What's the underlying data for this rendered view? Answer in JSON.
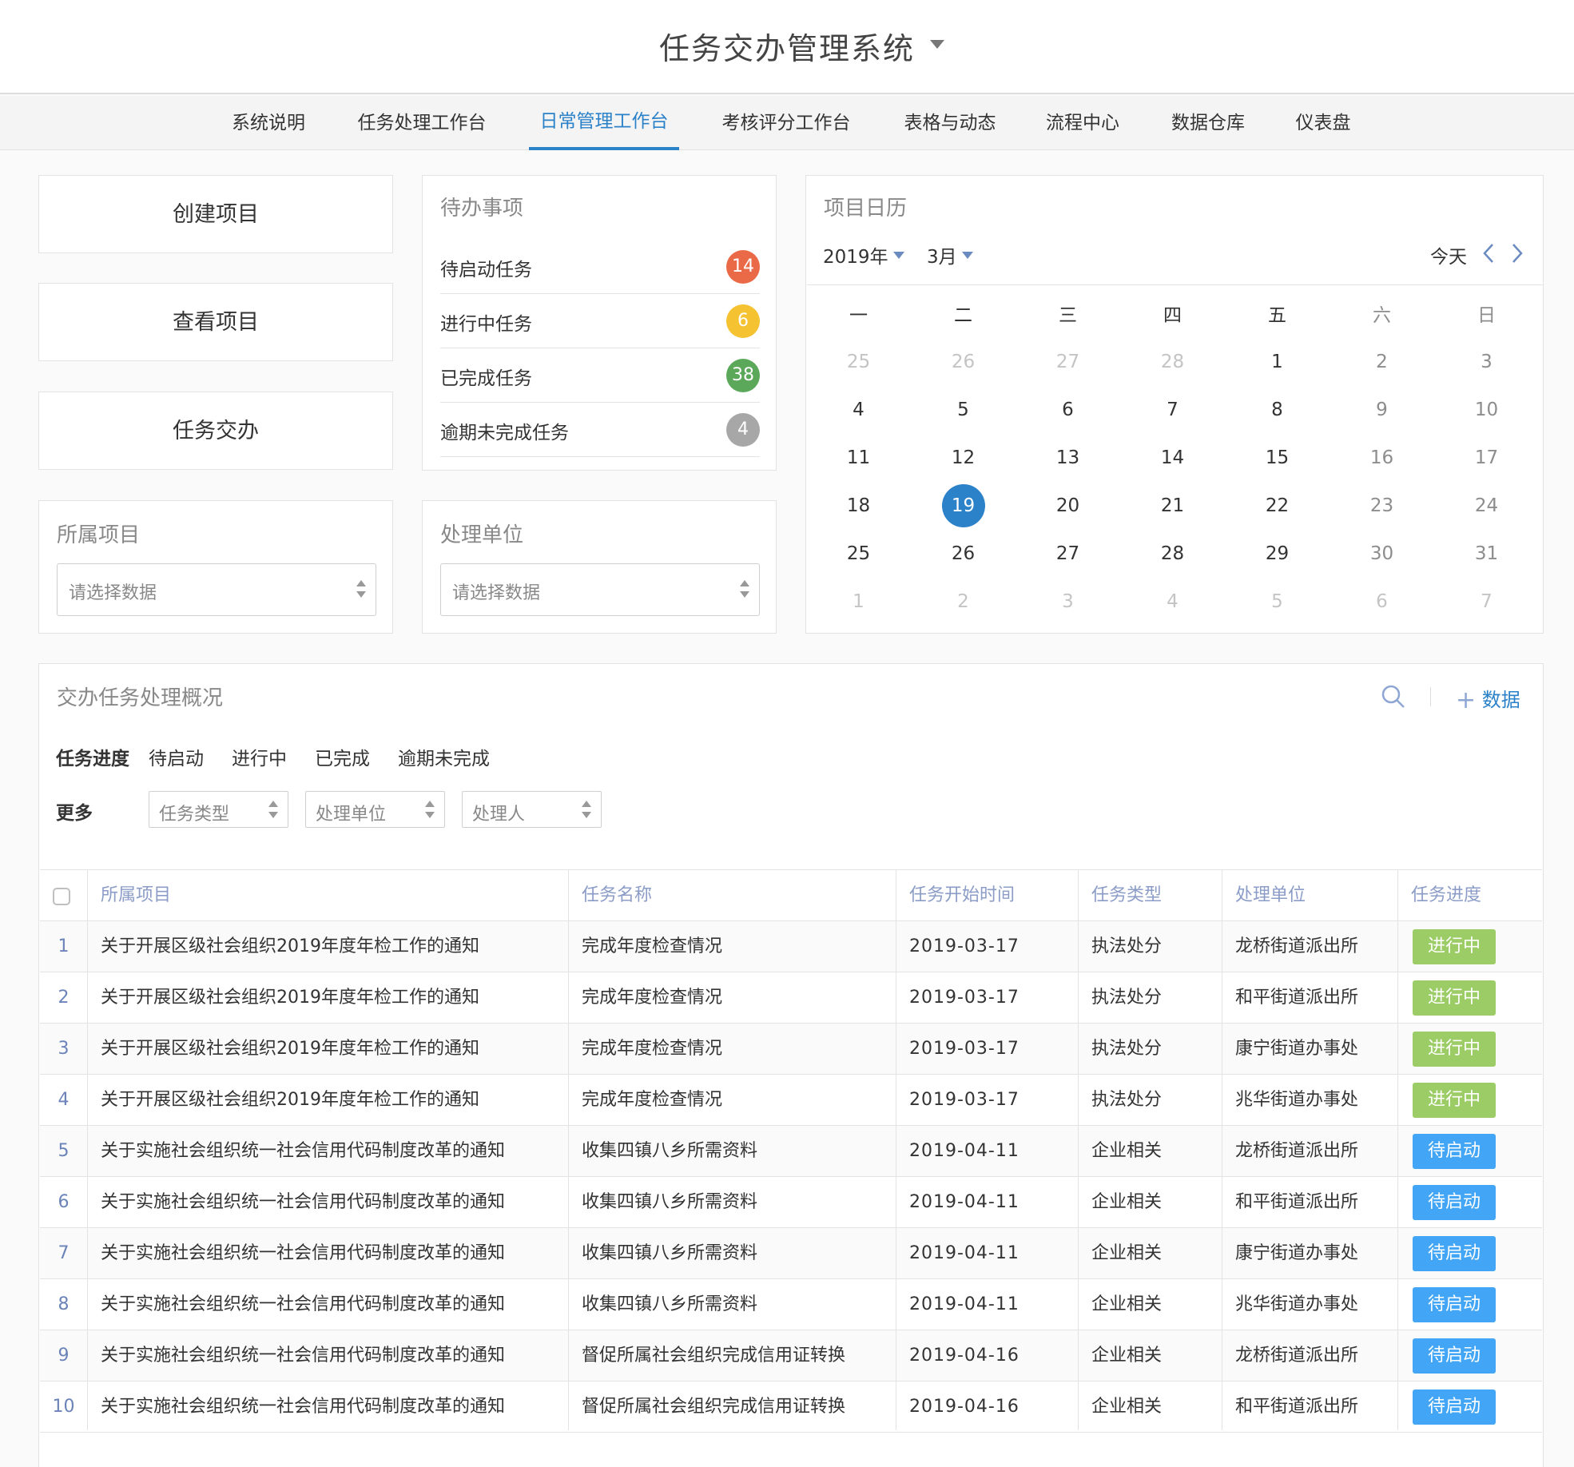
{
  "app": {
    "title": "任务交办管理系统"
  },
  "nav": {
    "tabs": [
      {
        "label": "系统说明"
      },
      {
        "label": "任务处理工作台"
      },
      {
        "label": "日常管理工作台",
        "active": true
      },
      {
        "label": "考核评分工作台"
      },
      {
        "label": "表格与动态"
      },
      {
        "label": "流程中心"
      },
      {
        "label": "数据仓库"
      },
      {
        "label": "仪表盘"
      }
    ]
  },
  "actions": {
    "create": "创建项目",
    "view": "查看项目",
    "assign": "任务交办"
  },
  "todo": {
    "title": "待办事项",
    "items": [
      {
        "label": "待启动任务",
        "count": "14",
        "color": "#ea6a48"
      },
      {
        "label": "进行中任务",
        "count": "6",
        "color": "#f5c232"
      },
      {
        "label": "已完成任务",
        "count": "38",
        "color": "#5ca85a"
      },
      {
        "label": "逾期未完成任务",
        "count": "4",
        "color": "#a7a7a7"
      }
    ]
  },
  "project_filter": {
    "title": "所属项目",
    "placeholder": "请选择数据"
  },
  "unit_filter": {
    "title": "处理单位",
    "placeholder": "请选择数据"
  },
  "calendar": {
    "title": "项目日历",
    "year": "2019年",
    "month": "3月",
    "today_label": "今天",
    "weekdays": [
      "一",
      "二",
      "三",
      "四",
      "五",
      "六",
      "日"
    ],
    "weeks": [
      [
        "25",
        "26",
        "27",
        "28",
        "1",
        "2",
        "3"
      ],
      [
        "4",
        "5",
        "6",
        "7",
        "8",
        "9",
        "10"
      ],
      [
        "11",
        "12",
        "13",
        "14",
        "15",
        "16",
        "17"
      ],
      [
        "18",
        "19",
        "20",
        "21",
        "22",
        "23",
        "24"
      ],
      [
        "25",
        "26",
        "27",
        "28",
        "29",
        "30",
        "31"
      ],
      [
        "1",
        "2",
        "3",
        "4",
        "5",
        "6",
        "7"
      ]
    ],
    "selected_day": "19"
  },
  "overview": {
    "title": "交办任务处理概况",
    "add_label": "数据",
    "progress_label": "任务进度",
    "progress_options": [
      "待启动",
      "进行中",
      "已完成",
      "逾期未完成"
    ],
    "more_label": "更多",
    "more_selects": [
      "任务类型",
      "处理单位",
      "处理人"
    ]
  },
  "table": {
    "headers": {
      "project": "所属项目",
      "task": "任务名称",
      "start": "任务开始时间",
      "type": "任务类型",
      "unit": "处理单位",
      "progress": "任务进度"
    },
    "status_colors": {
      "进行中": "#9ccc65",
      "待启动": "#42a5f5"
    },
    "rows": [
      {
        "no": "1",
        "project": "关于开展区级社会组织2019年度年检工作的通知",
        "task": "完成年度检查情况",
        "start": "2019-03-17",
        "type": "执法处分",
        "unit": "龙桥街道派出所",
        "progress": "进行中"
      },
      {
        "no": "2",
        "project": "关于开展区级社会组织2019年度年检工作的通知",
        "task": "完成年度检查情况",
        "start": "2019-03-17",
        "type": "执法处分",
        "unit": "和平街道派出所",
        "progress": "进行中"
      },
      {
        "no": "3",
        "project": "关于开展区级社会组织2019年度年检工作的通知",
        "task": "完成年度检查情况",
        "start": "2019-03-17",
        "type": "执法处分",
        "unit": "康宁街道办事处",
        "progress": "进行中"
      },
      {
        "no": "4",
        "project": "关于开展区级社会组织2019年度年检工作的通知",
        "task": "完成年度检查情况",
        "start": "2019-03-17",
        "type": "执法处分",
        "unit": "兆华街道办事处",
        "progress": "进行中"
      },
      {
        "no": "5",
        "project": "关于实施社会组织统一社会信用代码制度改革的通知",
        "task": "收集四镇八乡所需资料",
        "start": "2019-04-11",
        "type": "企业相关",
        "unit": "龙桥街道派出所",
        "progress": "待启动"
      },
      {
        "no": "6",
        "project": "关于实施社会组织统一社会信用代码制度改革的通知",
        "task": "收集四镇八乡所需资料",
        "start": "2019-04-11",
        "type": "企业相关",
        "unit": "和平街道派出所",
        "progress": "待启动"
      },
      {
        "no": "7",
        "project": "关于实施社会组织统一社会信用代码制度改革的通知",
        "task": "收集四镇八乡所需资料",
        "start": "2019-04-11",
        "type": "企业相关",
        "unit": "康宁街道办事处",
        "progress": "待启动"
      },
      {
        "no": "8",
        "project": "关于实施社会组织统一社会信用代码制度改革的通知",
        "task": "收集四镇八乡所需资料",
        "start": "2019-04-11",
        "type": "企业相关",
        "unit": "兆华街道办事处",
        "progress": "待启动"
      },
      {
        "no": "9",
        "project": "关于实施社会组织统一社会信用代码制度改革的通知",
        "task": "督促所属社会组织完成信用证转换",
        "start": "2019-04-16",
        "type": "企业相关",
        "unit": "龙桥街道派出所",
        "progress": "待启动"
      },
      {
        "no": "10",
        "project": "关于实施社会组织统一社会信用代码制度改革的通知",
        "task": "督促所属社会组织完成信用证转换",
        "start": "2019-04-16",
        "type": "企业相关",
        "unit": "和平街道派出所",
        "progress": "待启动"
      }
    ]
  }
}
